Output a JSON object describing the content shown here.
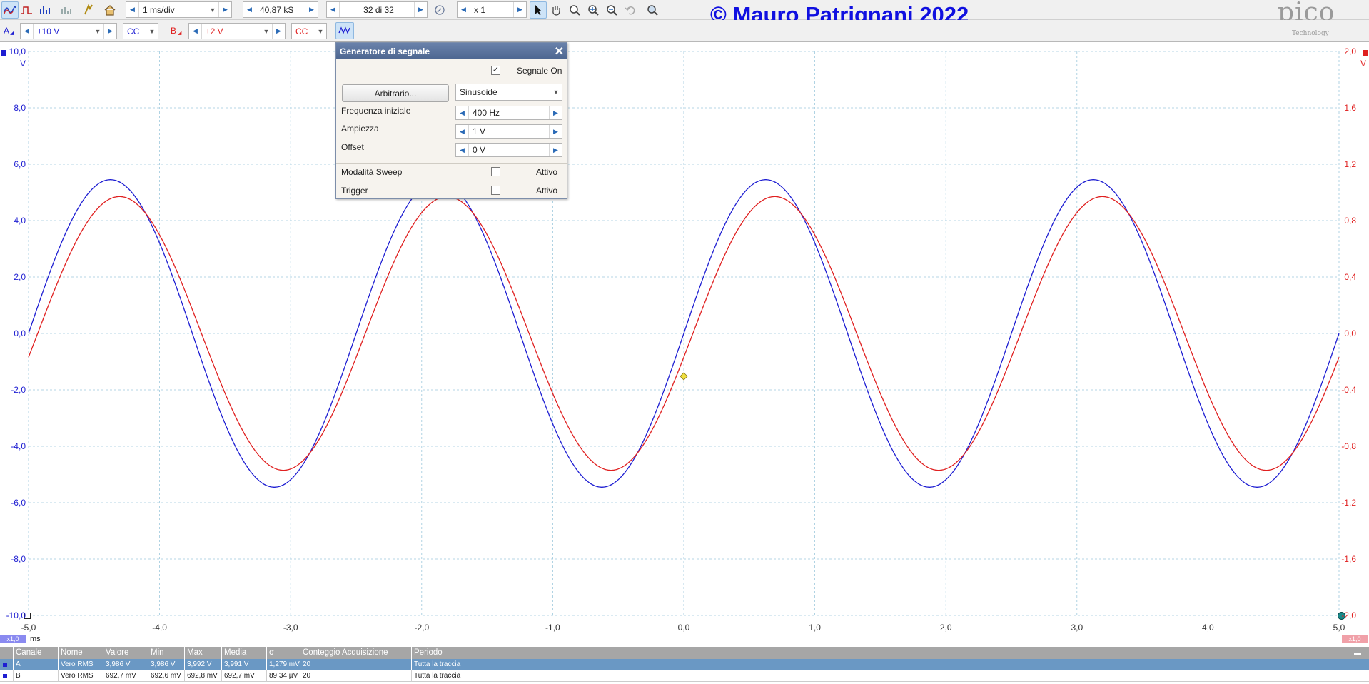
{
  "toolbar": {
    "timebase": "1 ms/div",
    "samples": "40,87 kS",
    "buffer": "32 di 32",
    "zoom": "x 1"
  },
  "watermark": "© Mauro Patrignani 2022",
  "logo": {
    "main": "pico",
    "sub": "Technology"
  },
  "channel_a": {
    "label": "A",
    "range": "±10 V",
    "coupling": "CC",
    "color": "#1e1ed2"
  },
  "channel_b": {
    "label": "B",
    "range": "±2 V",
    "coupling": "CC",
    "color": "#e02020"
  },
  "y_left_unit": "V",
  "y_right_unit": "V",
  "y_left_ticks": [
    "10,0",
    "8,0",
    "6,0",
    "4,0",
    "2,0",
    "0,0",
    "-2,0",
    "-4,0",
    "-6,0",
    "-8,0",
    "-10,0"
  ],
  "y_right_ticks": [
    "2,0",
    "1,6",
    "1,2",
    "0,8",
    "0,4",
    "0,0",
    "-0,4",
    "-0,8",
    "-1,2",
    "-1,6",
    "-2,0"
  ],
  "x_ticks": [
    "-5,0",
    "-4,0",
    "-3,0",
    "-2,0",
    "-1,0",
    "0,0",
    "1,0",
    "2,0",
    "3,0",
    "4,0",
    "5,0"
  ],
  "x_unit": "ms",
  "x_scale_left": "x1,0",
  "x_scale_right": "x1,0",
  "chart_data": {
    "type": "line",
    "xlim": [
      -5,
      5
    ],
    "series": [
      {
        "name": "A",
        "amplitude": 5.45,
        "frequency_khz": 0.4,
        "phase_deg": 0,
        "ylim": [
          -10,
          10
        ],
        "color": "#1e1ed2"
      },
      {
        "name": "B",
        "amplitude": 0.97,
        "frequency_khz": 0.4,
        "phase_deg": -10,
        "ylim": [
          -2,
          2
        ],
        "color": "#e02020"
      }
    ],
    "grid": true
  },
  "signal_generator": {
    "title": "Generatore di segnale",
    "signal_on_label": "Segnale On",
    "signal_on": true,
    "arbitrary_button": "Arbitrario...",
    "waveform": "Sinusoide",
    "start_freq_label": "Frequenza iniziale",
    "start_freq": "400 Hz",
    "amplitude_label": "Ampiezza",
    "amplitude": "1 V",
    "offset_label": "Offset",
    "offset": "0 V",
    "sweep_label": "Modalità Sweep",
    "sweep_active_label": "Attivo",
    "trigger_label": "Trigger",
    "trigger_active_label": "Attivo"
  },
  "measurements": {
    "headers": [
      "Canale",
      "Nome",
      "Valore",
      "Min",
      "Max",
      "Media",
      "σ",
      "Conteggio Acquisizione",
      "Periodo"
    ],
    "rows": [
      [
        "A",
        "Vero RMS",
        "3,986 V",
        "3,986 V",
        "3,992 V",
        "3,991 V",
        "1,279 mV",
        "20",
        "Tutta la traccia"
      ],
      [
        "B",
        "Vero RMS",
        "692,7 mV",
        "692,6 mV",
        "692,8 mV",
        "692,7 mV",
        "89,34 µV",
        "20",
        "Tutta la traccia"
      ]
    ]
  }
}
